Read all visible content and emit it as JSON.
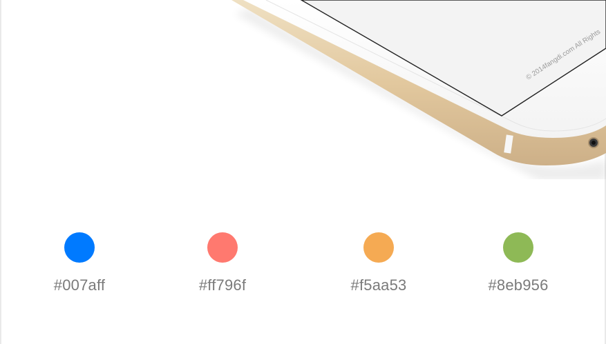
{
  "phone_screen": {
    "copyright": "© 2014fangdi.com All Rights"
  },
  "swatches": [
    {
      "hex": "#007aff",
      "color": "#007aff"
    },
    {
      "hex": "#ff796f",
      "color": "#ff796f"
    },
    {
      "hex": "#f5aa53",
      "color": "#f5aa53"
    },
    {
      "hex": "#8eb956",
      "color": "#8eb956"
    }
  ],
  "colors": {
    "phone_gold": "#e6cfa6",
    "screen_bg": "#f2f2f2",
    "background": "#ffffff"
  }
}
